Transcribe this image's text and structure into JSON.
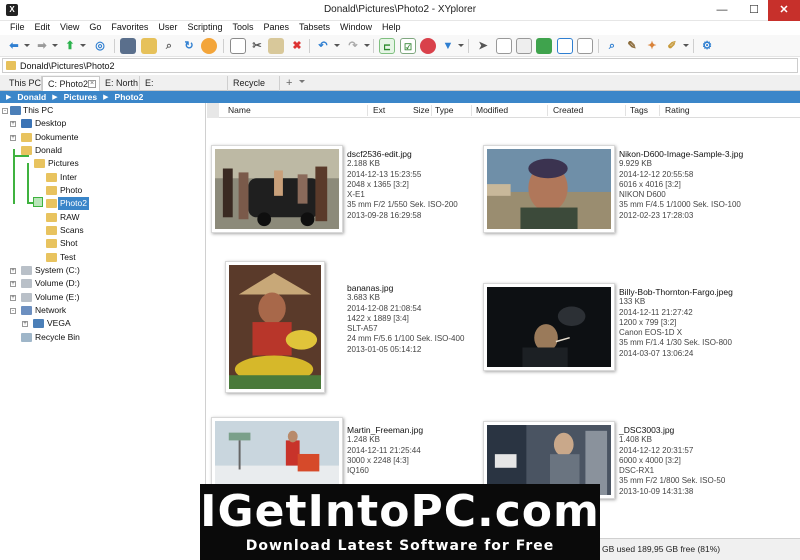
{
  "window": {
    "title": "Donald\\Pictures\\Photo2 - XYplorer",
    "app_icon": "X"
  },
  "controls": {
    "minimize": "—",
    "maximize": "☐",
    "close": "✕"
  },
  "menu": [
    "File",
    "Edit",
    "View",
    "Go",
    "Favorites",
    "User",
    "Scripting",
    "Tools",
    "Panes",
    "Tabsets",
    "Window",
    "Help"
  ],
  "address": {
    "path": "Donald\\Pictures\\Photo2"
  },
  "tabs": [
    {
      "label": "This PC"
    },
    {
      "label": "C: Photo2",
      "active": true
    },
    {
      "label": "E: North"
    },
    {
      "label": "E: MouseDownBlowUp"
    },
    {
      "label": "Recycle Bin"
    }
  ],
  "tab_add": "+",
  "breadcrumb": [
    "Donald",
    "Pictures",
    "Photo2"
  ],
  "tree": {
    "this_pc": "This PC",
    "desktop": "Desktop",
    "dokumente": "Dokumente",
    "donald": "Donald",
    "pictures": "Pictures",
    "inter": "Inter",
    "photo": "Photo",
    "photo2": "Photo2",
    "raw": "RAW",
    "scans": "Scans",
    "shot": "Shot",
    "test": "Test",
    "system_c": "System (C:)",
    "volume_d": "Volume (D:)",
    "volume_e": "Volume (E:)",
    "network": "Network",
    "vega": "VEGA",
    "recycle_bin": "Recycle Bin"
  },
  "columns": {
    "name": "Name",
    "ext": "Ext",
    "size": "Size",
    "type": "Type",
    "modified": "Modified",
    "created": "Created",
    "tags": "Tags",
    "rating": "Rating"
  },
  "files": [
    {
      "name": "dscf2536-edit.jpg",
      "size": "2.188 KB",
      "date": "2014-12-13 15:23:55",
      "dims": "2048 x 1365  [3:2]",
      "camera": "X-E1",
      "exif": "35 mm  F/2  1/550 Sek.  ISO-200",
      "created": "2013-09-28 16:29:58"
    },
    {
      "name": "Nikon-D600-Image-Sample-3.jpg",
      "size": "9.929 KB",
      "date": "2014-12-12 20:55:58",
      "dims": "6016 x 4016  [3:2]",
      "camera": "NIKON D600",
      "exif": "35 mm  F/4.5  1/1000 Sek.  ISO-100",
      "created": "2012-02-23 17:28:03"
    },
    {
      "name": "bananas.jpg",
      "size": "3.683 KB",
      "date": "2014-12-08 21:08:54",
      "dims": "1422 x 1889  [3:4]",
      "camera": "SLT-A57",
      "exif": "24 mm  F/5.6  1/100 Sek.  ISO-400",
      "created": "2013-01-05 05:14:12"
    },
    {
      "name": "Billy-Bob-Thornton-Fargo.jpeg",
      "size": "133 KB",
      "date": "2014-12-11 21:27:42",
      "dims": "1200 x 799  [3:2]",
      "camera": "Canon EOS-1D X",
      "exif": "35 mm  F/1.4  1/30 Sek.  ISO-800",
      "created": "2014-03-07 13:06:24"
    },
    {
      "name": "Martin_Freeman.jpg",
      "size": "1.248 KB",
      "date": "2014-12-11 21:25:44",
      "dims": "3000 x 2248  [4:3]",
      "camera": "IQ160",
      "exif": "",
      "created": ""
    },
    {
      "name": "_DSC3003.jpg",
      "size": "1.408 KB",
      "date": "2014-12-12 20:31:57",
      "dims": "6000 x 4000  [3:2]",
      "camera": "DSC-RX1",
      "exif": "35 mm  F/2  1/800 Sek.  ISO-50",
      "created": "2013-10-09 14:31:38"
    }
  ],
  "status": {
    "text": "GB used   189,95 GB free (81%)"
  },
  "watermark": {
    "title": "IGetIntoPC.com",
    "subtitle": "Download Latest Software for Free"
  },
  "colors": {
    "accent": "#3b86c9",
    "tree_guide": "#3fb23f",
    "folder": "#e8c35f",
    "close": "#c7302b"
  }
}
